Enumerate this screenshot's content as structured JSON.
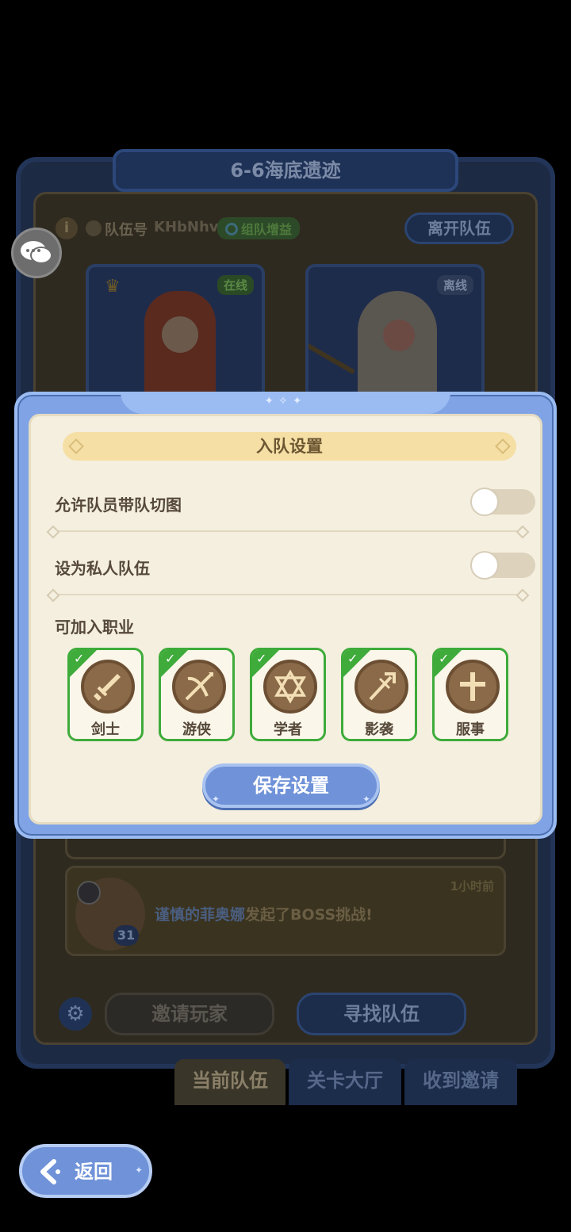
{
  "background_panel": {
    "stage_title": "6-6海底遗迹",
    "team_id_label": "队伍号",
    "team_id_value": "KHbNhv",
    "team_buff_label": "组队增益",
    "leave_button": "离开队伍",
    "members": [
      {
        "status": "在线"
      },
      {
        "status": "离线"
      }
    ],
    "message": {
      "time": "1小时前",
      "player_name": "谨慎的菲奥娜",
      "action": "发起了BOSS挑战!",
      "level": "31"
    },
    "invite_button": "邀请玩家",
    "find_team_button": "寻找队伍",
    "tabs": [
      "当前队伍",
      "关卡大厅",
      "收到邀请"
    ]
  },
  "modal": {
    "title": "入队设置",
    "options": [
      {
        "label": "允许队员带队切图",
        "enabled": false
      },
      {
        "label": "设为私人队伍",
        "enabled": false
      }
    ],
    "jobs_section_label": "可加入职业",
    "jobs": [
      {
        "name": "剑士",
        "icon": "sword-icon",
        "checked": true
      },
      {
        "name": "游侠",
        "icon": "crossbow-icon",
        "checked": true
      },
      {
        "name": "学者",
        "icon": "hexagram-icon",
        "checked": true
      },
      {
        "name": "影袭",
        "icon": "trident-icon",
        "checked": true
      },
      {
        "name": "服事",
        "icon": "cross-icon",
        "checked": true
      }
    ],
    "save_button": "保存设置"
  },
  "back_button": "返回",
  "colors": {
    "modal_frame": "#7fa3e4",
    "modal_bg": "#f5efdf",
    "check_green": "#3eab3a",
    "button_blue": "#6f92d8"
  }
}
